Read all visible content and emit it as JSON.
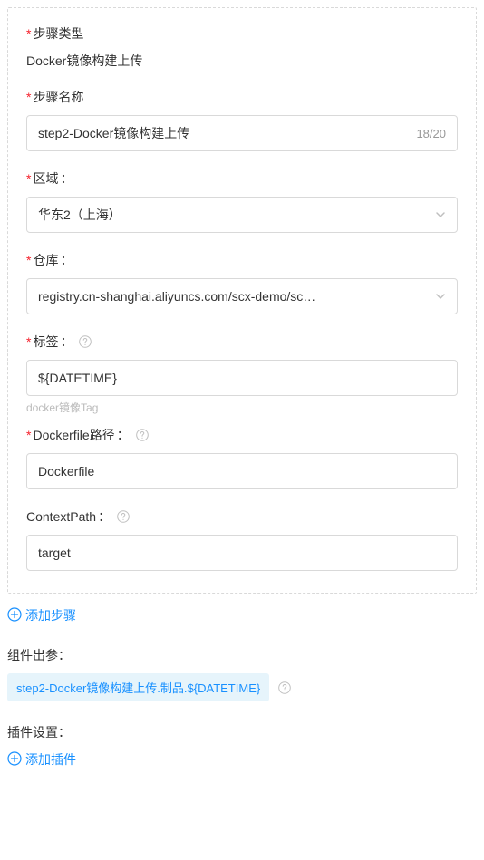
{
  "step": {
    "typeLabel": "步骤类型",
    "typeValue": "Docker镜像构建上传",
    "nameLabel": "步骤名称",
    "nameValue": "step2-Docker镜像构建上传",
    "nameCount": "18/20",
    "regionLabel": "区域",
    "regionValue": "华东2（上海）",
    "repoLabel": "仓库",
    "repoValue": "registry.cn-shanghai.aliyuncs.com/scx-demo/sc…",
    "tagLabel": "标签",
    "tagValue": "${DATETIME}",
    "tagHint": "docker镜像Tag",
    "dockerfileLabel": "Dockerfile路径",
    "dockerfileValue": "Dockerfile",
    "contextPathLabel": "ContextPath",
    "contextPathValue": "target"
  },
  "addStepLabel": "添加步骤",
  "outputSectionLabel": "组件出参",
  "outputTag": "step2-Docker镜像构建上传.制品.${DATETIME}",
  "pluginSectionLabel": "插件设置",
  "addPluginLabel": "添加插件",
  "colon": "：",
  "colonSpace": "： "
}
